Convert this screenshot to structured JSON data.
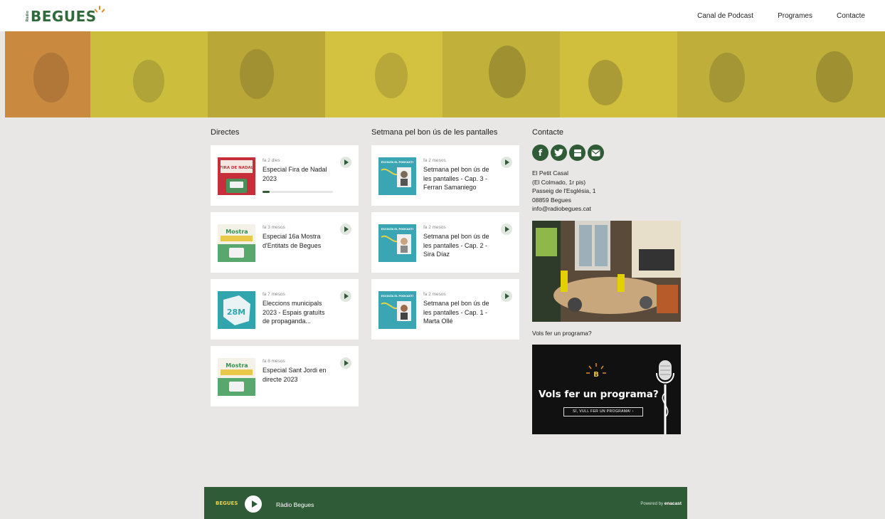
{
  "header": {
    "logo_small": "Ràdio",
    "logo_text": "BEGUES",
    "nav": [
      "Canal de Podcast",
      "Programes",
      "Contacte"
    ]
  },
  "columns": {
    "directes": {
      "title": "Directes",
      "cards": [
        {
          "meta": "fa 2 dies",
          "title": "Especial Fira de Nadal 2023",
          "progress": 0.1
        },
        {
          "meta": "fa 3 mesos",
          "title": "Especial 16a Mostra d'Entitats de Begues"
        },
        {
          "meta": "fa 7 mesos",
          "title": "Eleccions municipals 2023 - Espais gratuïts de propaganda..."
        },
        {
          "meta": "fa 8 mesos",
          "title": "Especial Sant Jordi en directe 2023"
        }
      ]
    },
    "setmana": {
      "title": "Setmana pel bon ús de les pantalles",
      "cards": [
        {
          "meta": "fa 2 mesos",
          "title": "Setmana pel bon ús de les pantalles - Cap. 3 - Ferran Samaniego"
        },
        {
          "meta": "fa 2 mesos",
          "title": "Setmana pel bon ús de les pantalles - Cap. 2 - Sira Díaz"
        },
        {
          "meta": "fa 2 mesos",
          "title": "Setmana pel bon ús de les pantalles - Cap. 1 - Marta Ollé"
        }
      ]
    },
    "contacte": {
      "title": "Contacte",
      "socials": [
        "facebook-icon",
        "twitter-icon",
        "youtube-icon",
        "mail-icon"
      ],
      "address": [
        "El Petit Casal",
        "(El Colmado, 1r pis)",
        "Passeig de l'Església, 1",
        "08859 Begues",
        "info@radiobegues.cat"
      ],
      "vols_label": "Vols fer un programa?",
      "promo_heading": "Vols fer un programa?",
      "promo_cta": "SÍ, VULL FER UN PROGRAMA! ›"
    }
  },
  "thumb_texts": {
    "fira": "FIRA DE NADAL",
    "mostra": "Mostra",
    "eleccions": "28M",
    "escolta": "ESCOLTA EL PODCAST!"
  },
  "player": {
    "logo": "BEGUES",
    "station": "Ràdio Begues",
    "powered_label": "Powered by",
    "powered_brand": "enacast"
  },
  "colors": {
    "brand_green": "#2f5b36",
    "background": "#e9e6e6",
    "banner_yellow": "#d6c43a"
  }
}
